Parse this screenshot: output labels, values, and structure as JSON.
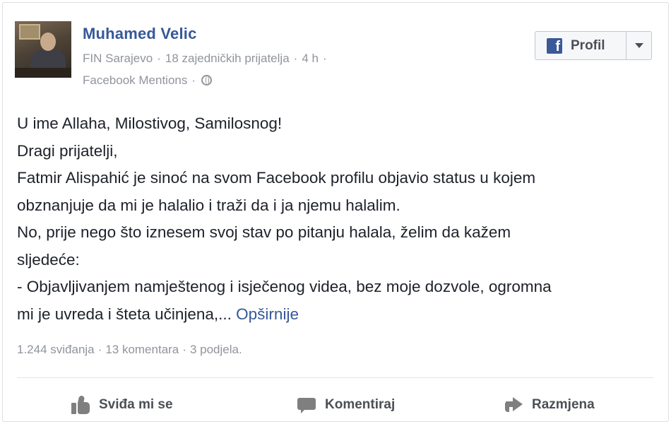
{
  "post": {
    "author": "Muhamed Velic",
    "meta_line1": [
      "FIN Sarajevo",
      "18 zajedničkih prijatelja",
      "4 h"
    ],
    "meta_line1_trailing_sep": "·",
    "via": "Facebook Mentions",
    "separator": "·",
    "privacy_icon": "globe-icon",
    "profile_button": {
      "label": "Profil",
      "icon": "facebook-icon",
      "icon_glyph": "f",
      "dropdown_icon": "caret-down-icon"
    },
    "text_lines": [
      "U ime Allaha, Milostivog, Samilosnog!",
      "Dragi prijatelji,",
      "Fatmir Alispahić je sinoć na svom Facebook profilu objavio status u kojem",
      "obznanjuje da mi je halalio i traži da i ja njemu halalim.",
      "No, prije nego što iznesem svoj stav po pitanju halala, želim da kažem",
      "sljedeće:",
      "- Objavljivanjem namještenog i isječenog videa, bez moje dozvole, ogromna"
    ],
    "last_line": "mi je uvreda i šteta učinjena,...",
    "see_more": "Opširnije",
    "stats": {
      "likes": "1.244 sviđanja",
      "comments": "13 komentara",
      "shares": "3 podjela."
    },
    "actions": {
      "like": "Sviđa mi se",
      "comment": "Komentiraj",
      "share": "Razmjena"
    }
  },
  "colors": {
    "link": "#365899",
    "meta": "#90949c",
    "text": "#1d2129",
    "facebook_blue": "#3b5998",
    "action_gray": "#4b4f56"
  }
}
